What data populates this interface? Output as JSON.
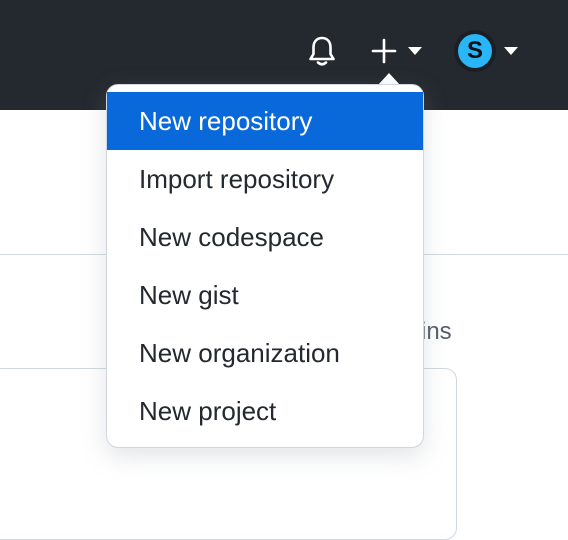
{
  "header": {
    "bell_icon": "bell-icon",
    "plus_icon": "plus-icon",
    "avatar_letter": "S",
    "caret_icon": "caret-down-icon"
  },
  "background": {
    "partial_text": "ins"
  },
  "dropdown": {
    "items": [
      {
        "label": "New repository",
        "active": true
      },
      {
        "label": "Import repository",
        "active": false
      },
      {
        "label": "New codespace",
        "active": false
      },
      {
        "label": "New gist",
        "active": false
      },
      {
        "label": "New organization",
        "active": false
      },
      {
        "label": "New project",
        "active": false
      }
    ]
  },
  "colors": {
    "header_bg": "#24292f",
    "accent": "#0969da",
    "avatar_bg": "#29b6f6"
  }
}
